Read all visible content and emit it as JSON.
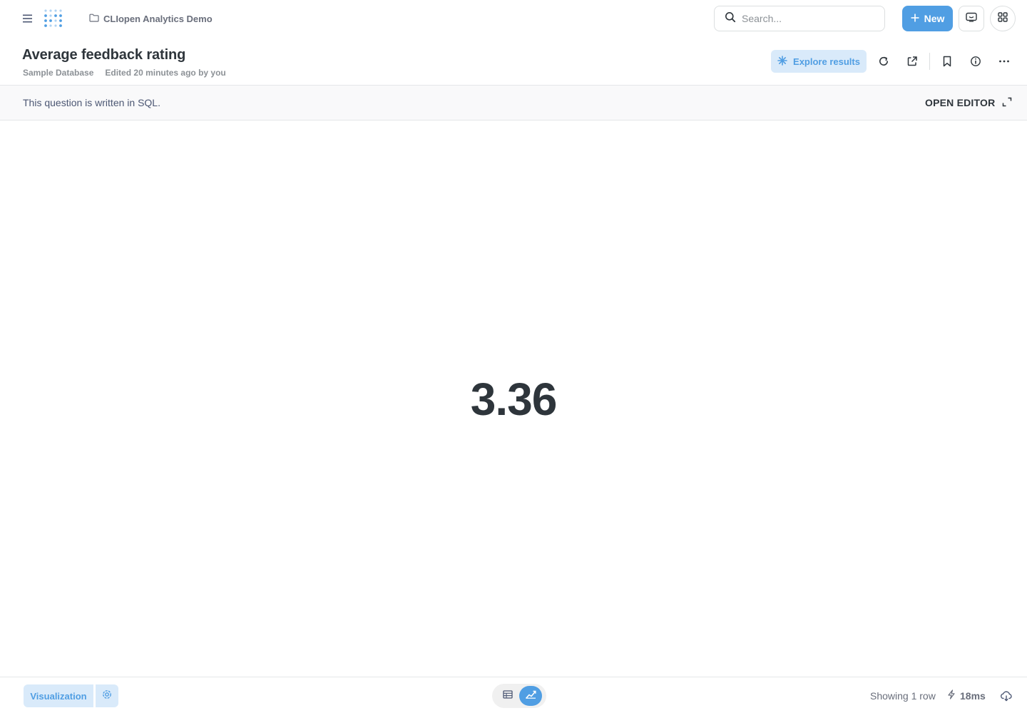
{
  "nav": {
    "collection": "CLIopen Analytics Demo",
    "search_placeholder": "Search...",
    "new_label": "New"
  },
  "question": {
    "title": "Average feedback rating",
    "database": "Sample Database",
    "edited": "Edited 20 minutes ago by you",
    "explore_label": "Explore results"
  },
  "sql_notice": {
    "message": "This question is written in SQL.",
    "open_editor_label": "OPEN EDITOR"
  },
  "result": {
    "value": "3.36"
  },
  "footer": {
    "visualization_label": "Visualization",
    "row_count": "Showing 1 row",
    "timing": "18ms",
    "active_view": "chart"
  },
  "colors": {
    "brand": "#509ee3",
    "brand_light": "#d9eafa",
    "text_dark": "#2e353b",
    "text_muted": "#8c9196"
  },
  "icons": {
    "menu": "hamburger-icon",
    "logo": "dot-grid-logo",
    "collection": "folder-icon",
    "search": "search-icon",
    "new": "plus-icon",
    "ai": "chatbot-icon",
    "apps": "grid-icon",
    "explore": "sparkle-icon",
    "refresh": "refresh-icon",
    "share": "share-icon",
    "bookmark": "bookmark-icon",
    "info": "info-icon",
    "more": "ellipsis-icon",
    "expand": "expand-icon",
    "settings": "gear-icon",
    "table_view": "table-icon",
    "chart_view": "line-chart-icon",
    "timing": "bolt-icon",
    "download": "cloud-download-icon"
  }
}
